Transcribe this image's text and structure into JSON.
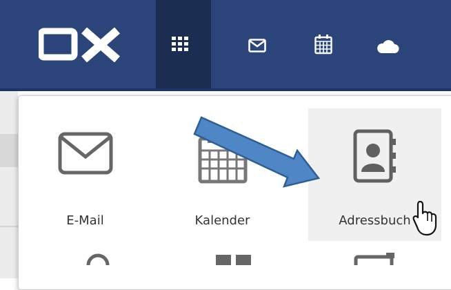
{
  "topbar": {
    "logo": "OX",
    "icons": [
      "apps-grid-icon",
      "mail-icon",
      "calendar-icon",
      "cloud-icon"
    ]
  },
  "launcher": {
    "apps": [
      {
        "label": "E-Mail",
        "icon": "mail-icon"
      },
      {
        "label": "Kalender",
        "icon": "calendar-icon"
      },
      {
        "label": "Adressbuch",
        "icon": "address-book-icon",
        "hovered": true
      }
    ]
  },
  "colors": {
    "topbar": "#2b4479",
    "active": "#1c2d52",
    "arrow": "#4f86c6",
    "icon_gray": "#666666"
  }
}
